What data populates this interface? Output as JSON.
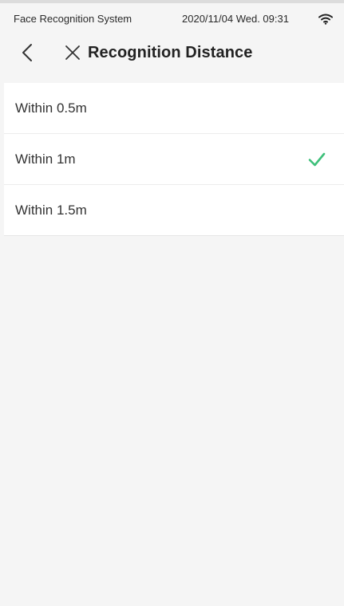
{
  "status_bar": {
    "app_name": "Face Recognition System",
    "datetime": "2020/11/04  Wed.  09:31",
    "wifi_icon": "wifi-icon"
  },
  "header": {
    "back_icon": "chevron-left-icon",
    "close_icon": "close-icon",
    "title": "Recognition Distance"
  },
  "options": [
    {
      "label": "Within 0.5m",
      "selected": false
    },
    {
      "label": "Within 1m",
      "selected": true
    },
    {
      "label": "Within 1.5m",
      "selected": false
    }
  ],
  "colors": {
    "check": "#3ec07a",
    "background": "#f5f5f5"
  }
}
